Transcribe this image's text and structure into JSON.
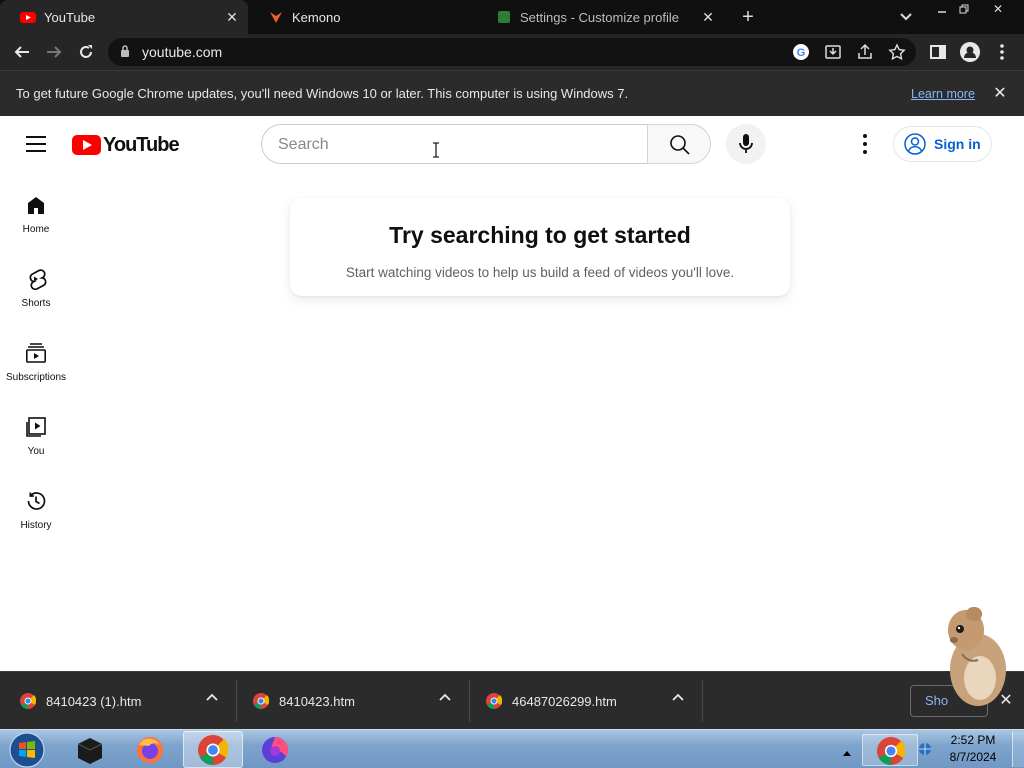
{
  "browser": {
    "tabs": [
      {
        "title": "YouTube",
        "active": true,
        "favicon": "youtube-icon"
      },
      {
        "title": "Kemono",
        "active": false,
        "favicon": "kemono-icon"
      },
      {
        "title": "Settings - Customize profile",
        "active": false,
        "favicon": "settings-icon"
      }
    ],
    "url": "youtube.com",
    "infobar": {
      "message": "To get future Google Chrome updates, you'll need Windows 10 or later. This computer is using Windows 7.",
      "link": "Learn more"
    }
  },
  "youtube": {
    "logo_text": "YouTube",
    "search_placeholder": "Search",
    "sign_in": "Sign in",
    "sidebar": [
      {
        "label": "Home",
        "icon": "home-icon"
      },
      {
        "label": "Shorts",
        "icon": "shorts-icon"
      },
      {
        "label": "Subscriptions",
        "icon": "subscriptions-icon"
      },
      {
        "label": "You",
        "icon": "you-icon"
      },
      {
        "label": "History",
        "icon": "history-icon"
      }
    ],
    "empty_state": {
      "heading": "Try searching to get started",
      "subtext": "Start watching videos to help us build a feed of videos you'll love."
    }
  },
  "downloads": {
    "items": [
      "8410423 (1).htm",
      "8410423.htm",
      "46487026299.htm"
    ],
    "show_all": "Sho"
  },
  "taskbar": {
    "time": "2:52 PM",
    "date": "8/7/2024"
  },
  "colors": {
    "youtube_red": "#ff0000",
    "link_blue": "#065fd4",
    "chrome_dark": "#262626"
  }
}
